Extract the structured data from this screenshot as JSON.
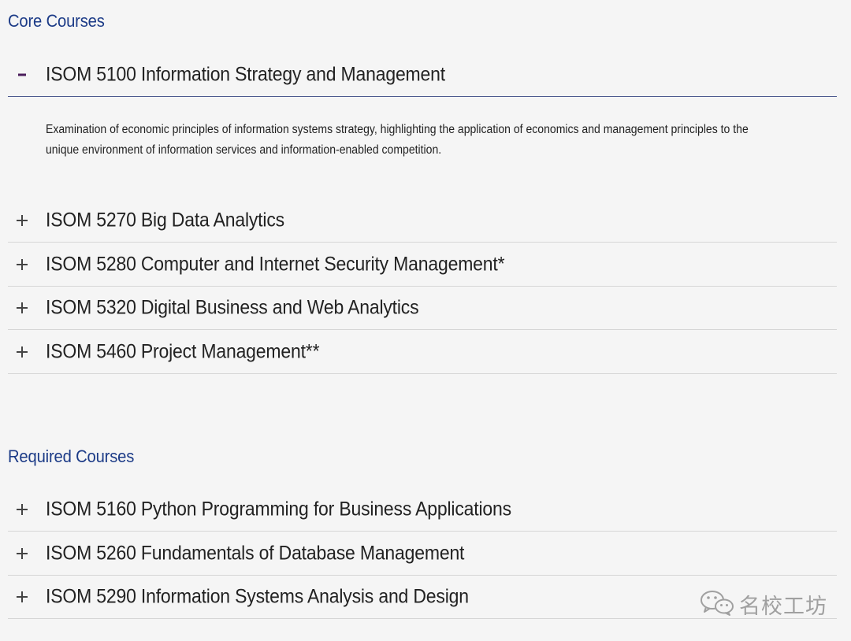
{
  "core": {
    "title": "Core Courses",
    "items": [
      {
        "label": "ISOM 5100 Information Strategy and Management",
        "expanded": true,
        "description": "Examination of economic principles of information systems strategy, highlighting the application of economics and management principles to the unique environment of information services and information-enabled competition."
      },
      {
        "label": "ISOM 5270 Big Data Analytics",
        "expanded": false
      },
      {
        "label": "ISOM 5280 Computer and Internet Security Management*",
        "expanded": false
      },
      {
        "label": "ISOM 5320 Digital Business and Web Analytics",
        "expanded": false
      },
      {
        "label": "ISOM 5460 Project Management**",
        "expanded": false
      }
    ]
  },
  "required": {
    "title": "Required Courses",
    "items": [
      {
        "label": "ISOM 5160 Python Programming for Business Applications",
        "expanded": false
      },
      {
        "label": "ISOM 5260 Fundamentals of Database Management",
        "expanded": false
      },
      {
        "label": "ISOM 5290 Information Systems Analysis and Design",
        "expanded": false
      }
    ]
  },
  "watermark": {
    "text": "名校工坊",
    "icon": "wechat-icon"
  },
  "colors": {
    "section_title": "#1c3b87",
    "collapse_icon": "#4a1d5c",
    "expand_icon": "#444444",
    "divider": "#d6d6d6",
    "open_divider": "#4d5a8f",
    "background": "#f5f5f5"
  },
  "icons": {
    "expanded": "minus-icon",
    "collapsed": "plus-icon"
  }
}
